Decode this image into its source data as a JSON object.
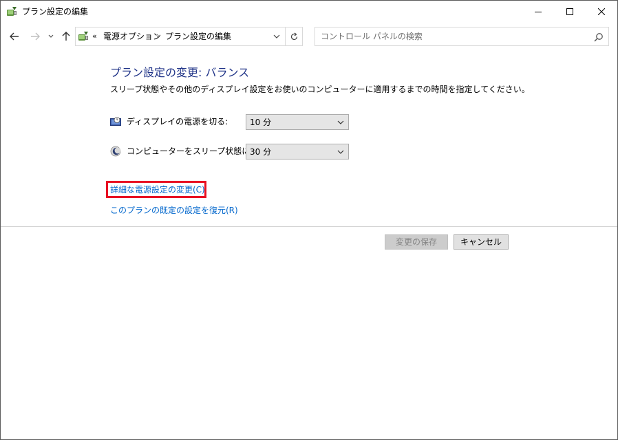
{
  "window": {
    "title": "プラン設定の編集"
  },
  "address": {
    "prefix": "«",
    "breadcrumb": [
      "電源オプション",
      "プラン設定の編集"
    ],
    "separator": "›"
  },
  "search": {
    "placeholder": "コントロール パネルの検索"
  },
  "content": {
    "heading": "プラン設定の変更: バランス",
    "description": "スリープ状態やその他のディスプレイ設定をお使いのコンピューターに適用するまでの時間を指定してください。",
    "settings": [
      {
        "label": "ディスプレイの電源を切る:",
        "value": "10 分",
        "icon": "monitor-timer-icon"
      },
      {
        "label": "コンピューターをスリープ状態にする:",
        "value": "30 分",
        "icon": "moon-icon"
      }
    ],
    "links": {
      "advanced": "詳細な電源設定の変更(C)",
      "restore": "このプランの既定の設定を復元(R)"
    }
  },
  "buttons": {
    "save": "変更の保存",
    "cancel": "キャンセル"
  },
  "colors": {
    "heading": "#1e3287",
    "link": "#0066cc",
    "highlight": "#e81123"
  }
}
